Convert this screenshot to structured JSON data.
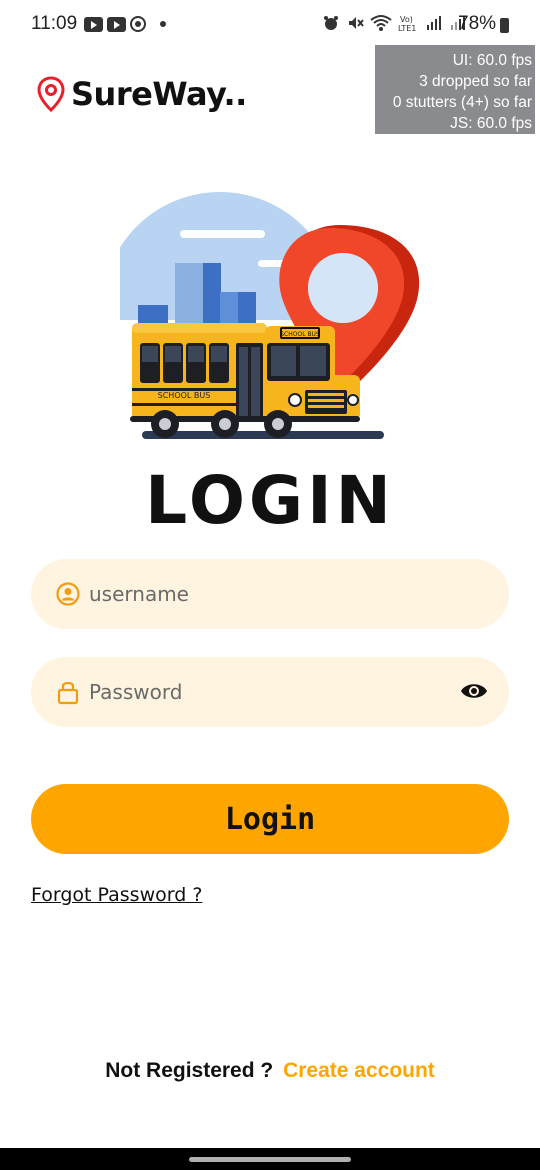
{
  "status_bar": {
    "time": "11:09",
    "battery": "78%",
    "icons": [
      "youtube-icon",
      "youtube-icon",
      "record-icon",
      "dot-icon",
      "alarm-icon",
      "mute-icon",
      "wifi-icon",
      "volte-icon",
      "signal-icon",
      "battery-icon"
    ]
  },
  "fps_overlay": {
    "line1": "UI: 60.0 fps",
    "line2": "3 dropped so far",
    "line3": "0 stutters (4+) so far",
    "line4": "JS: 60.0 fps"
  },
  "brand": {
    "title": "SureWay..",
    "icon": "location-pin-icon"
  },
  "hero": {
    "bus_label": "SCHOOL BUS",
    "bus_side_label": "SCHOOL BUS"
  },
  "login": {
    "heading": "LOGIN",
    "username_placeholder": "username",
    "password_placeholder": "Password",
    "button_label": "Login",
    "forgot_label": "Forgot Password ?"
  },
  "footer": {
    "question": "Not Registered ?",
    "create_label": "Create account"
  },
  "colors": {
    "accent": "#ffa500",
    "field_bg": "#fff4df",
    "pin_red": "#e63a1e"
  }
}
